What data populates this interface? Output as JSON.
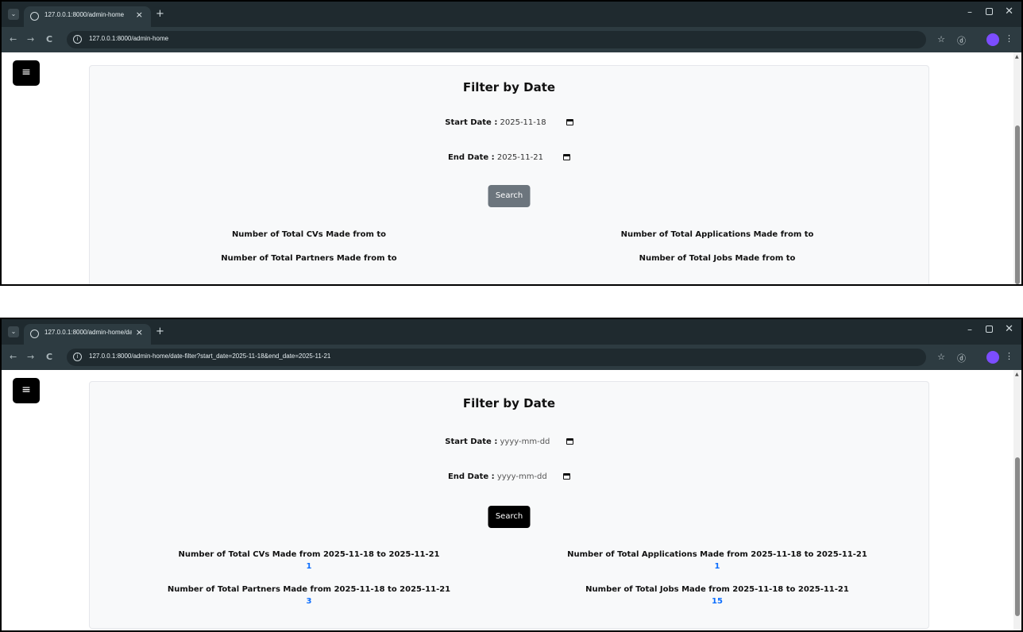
{
  "shot1": {
    "tab_title": "127.0.0.1:8000/admin-home",
    "url": "127.0.0.1:8000/admin-home",
    "page": {
      "menu_icon": "≡",
      "title": "Filter by Date",
      "start_label": "Start Date :",
      "start_value": "2025-11-18",
      "end_label": "End Date :",
      "end_value": "2025-11-21",
      "search_label": "Search",
      "stats": [
        {
          "label": "Number of Total CVs Made from to",
          "value": ""
        },
        {
          "label": "Number of Total Applications Made from to",
          "value": ""
        },
        {
          "label": "Number of Total Partners Made from to",
          "value": ""
        },
        {
          "label": "Number of Total Jobs Made from to",
          "value": ""
        }
      ]
    }
  },
  "shot2": {
    "tab_title": "127.0.0.1:8000/admin-home/da",
    "url": "127.0.0.1:8000/admin-home/date-filter?start_date=2025-11-18&end_date=2025-11-21",
    "page": {
      "menu_icon": "≡",
      "title": "Filter by Date",
      "start_label": "Start Date :",
      "start_placeholder": "yyyy-mm-dd",
      "end_label": "End Date :",
      "end_placeholder": "yyyy-mm-dd",
      "search_label": "Search",
      "stats": [
        {
          "label": "Number of Total CVs Made from 2025-11-18 to 2025-11-21",
          "value": "1"
        },
        {
          "label": "Number of Total Applications Made from 2025-11-18 to 2025-11-21",
          "value": "1"
        },
        {
          "label": "Number of Total Partners Made from 2025-11-18 to 2025-11-21",
          "value": "3"
        },
        {
          "label": "Number of Total Jobs Made from 2025-11-18 to 2025-11-21",
          "value": "15"
        }
      ]
    }
  },
  "browser": {
    "tab_close": "×",
    "new_tab": "+",
    "back": "←",
    "forward": "→",
    "reload": "C",
    "star": "☆",
    "extensions": "ⓓ",
    "kebab": "⋮",
    "min": "–",
    "close": "✕"
  },
  "colors": {
    "chrome_dark": "#1f2a2f",
    "chrome_bar": "#2d3b41",
    "search_disabled": "#6c757d",
    "search_active": "#000000",
    "stat_value": "#0d6efd"
  }
}
